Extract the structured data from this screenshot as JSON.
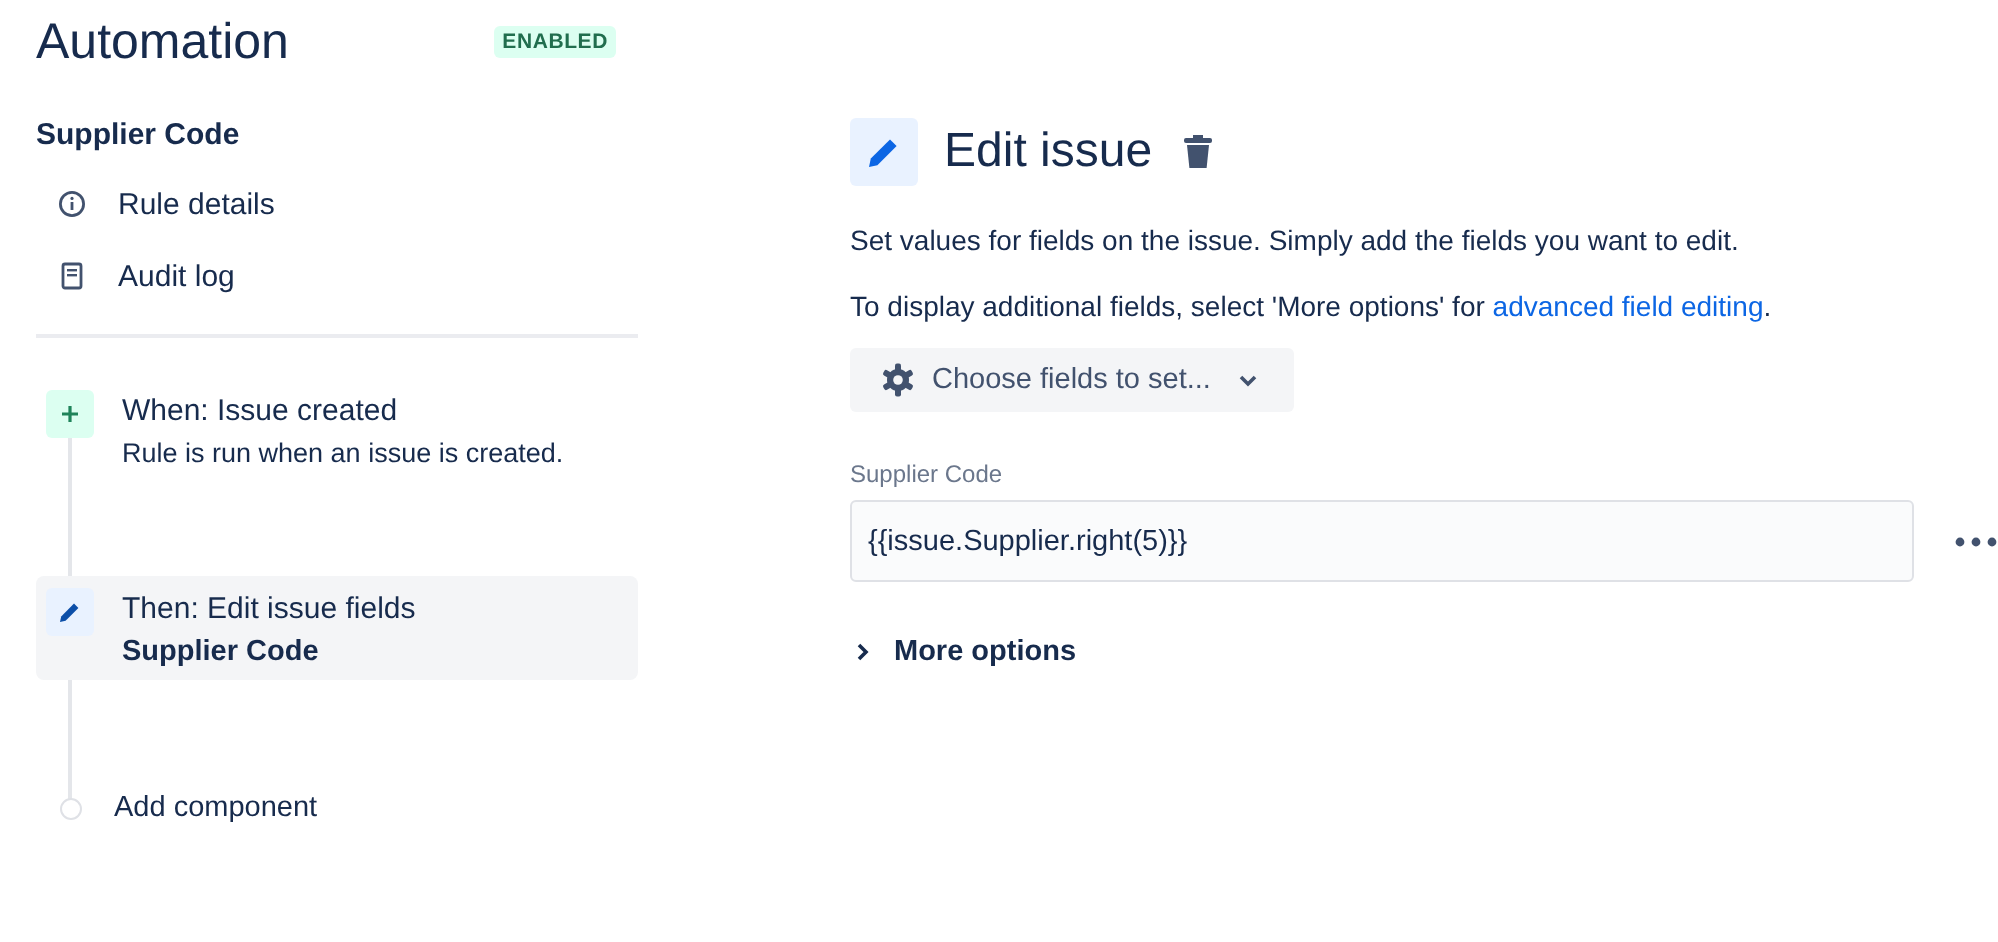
{
  "header": {
    "title": "Automation",
    "status": "ENABLED"
  },
  "rule": {
    "name": "Supplier Code",
    "nav": [
      {
        "kind": "info",
        "label": "Rule details"
      },
      {
        "kind": "log",
        "label": "Audit log"
      }
    ]
  },
  "components": [
    {
      "kind": "trigger",
      "title": "When: Issue created",
      "subtitle": "Rule is run when an issue is created.",
      "selected": false
    },
    {
      "kind": "action",
      "title": "Then: Edit issue fields",
      "subtitle": "Supplier Code",
      "selected": true
    }
  ],
  "add_component": "Add component",
  "panel": {
    "title": "Edit issue",
    "description": "Set values for fields on the issue. Simply add the fields you want to edit.",
    "hint": {
      "text": "To display additional fields, select 'More options' for ",
      "link": "advanced field editing",
      "after": "."
    },
    "choose_button": "Choose fields to set...",
    "field": {
      "label": "Supplier Code",
      "value": "{{issue.Supplier.right(5)}}"
    },
    "more_options": {
      "label": "More options",
      "expanded": false
    }
  }
}
